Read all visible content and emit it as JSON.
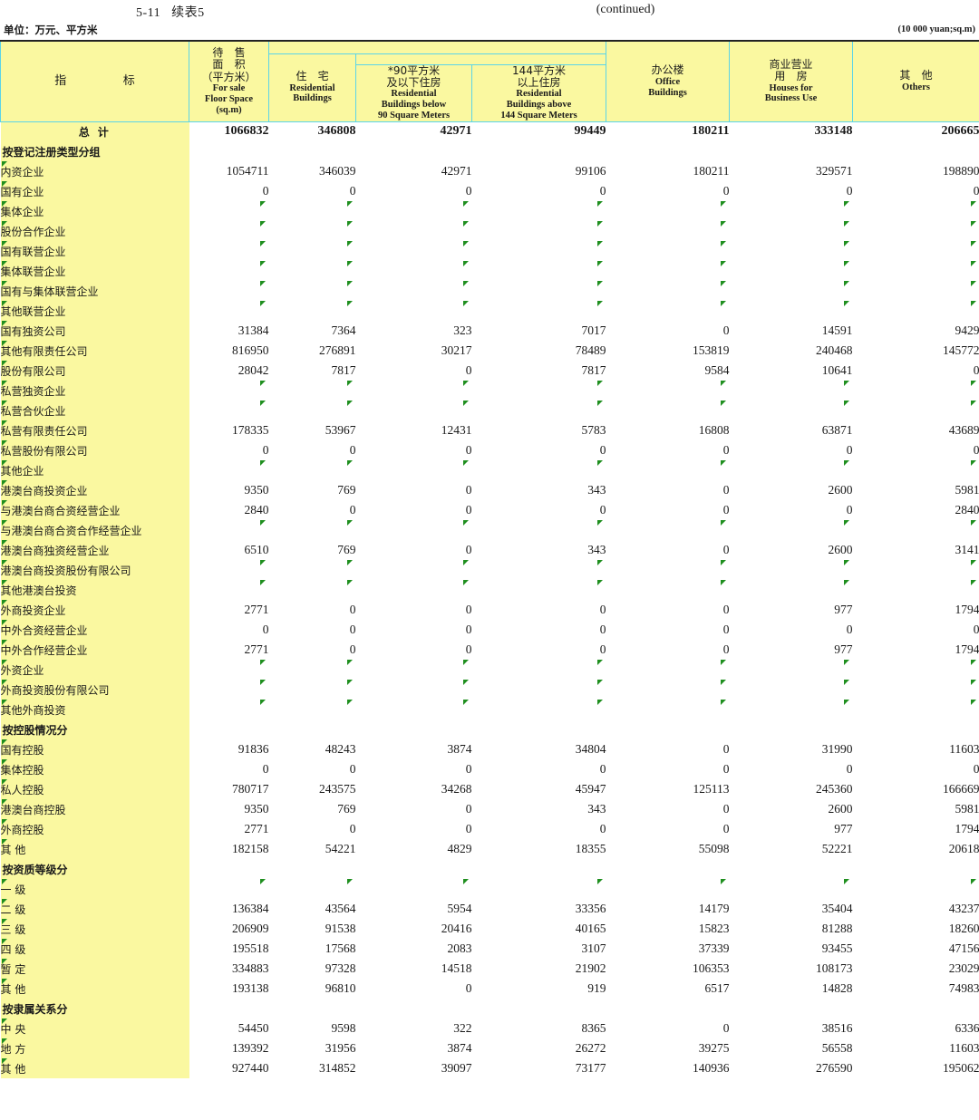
{
  "page": {
    "table_number": "5-11",
    "table_title_cn": "续表5",
    "continued_label": "(continued)",
    "unit_cn": "单位：万元、平方米",
    "unit_en": "(10 000 yuan;sq.m)",
    "colors": {
      "header_fill": "#FAF8A0",
      "grid_line": "#5BD4E8",
      "outer_line": "#222222",
      "error_marker": "#1F8F1F"
    }
  },
  "header": {
    "indicator_left": "指",
    "indicator_right": "标",
    "columns": [
      {
        "cn1": "待  售",
        "cn2": "面  积",
        "cn3": "（平方米）",
        "en1": "For sale",
        "en2": "Floor Space",
        "en3": "(sq.m)"
      },
      {
        "cn1": "住  宅",
        "en1": "Residential",
        "en2": "Buildings"
      },
      {
        "cn1": "*90平方米",
        "cn2": "及以下住房",
        "en1": "Residential",
        "en2": "Buildings below",
        "en3": "90 Square Meters"
      },
      {
        "cn1": "144平方米",
        "cn2": "以上住房",
        "en1": "Residential",
        "en2": "Buildings above",
        "en3": "144 Square Meters"
      },
      {
        "cn1": "办公楼",
        "en1": "Office",
        "en2": "Buildings"
      },
      {
        "cn1": "商业营业",
        "cn2": "用  房",
        "en1": "Houses for",
        "en2": "Business Use"
      },
      {
        "cn1": "其  他",
        "en1": "Others"
      }
    ]
  },
  "chart_data": {
    "type": "table",
    "title": "5-11 续表5 (continued)",
    "units": "万元、平方米 / 10 000 yuan; sq.m",
    "columns": [
      "待售面积（平方米） For sale Floor Space (sq.m)",
      "住宅 Residential Buildings",
      "*90平方米及以下住房 Residential Buildings below 90 Square Meters",
      "144平方米以上住房 Residential Buildings above 144 Square Meters",
      "办公楼 Office Buildings",
      "商业营业用房 Houses for Business Use",
      "其他 Others"
    ],
    "rows": [
      {
        "label": "总        计",
        "kind": "total",
        "indent": 0,
        "values": [
          "1066832",
          "346808",
          "42971",
          "99449",
          "180211",
          "333148",
          "206665"
        ]
      },
      {
        "label": "按登记注册类型分组",
        "kind": "group",
        "indent": 0,
        "values": [
          "",
          "",
          "",
          "",
          "",
          "",
          ""
        ]
      },
      {
        "label": "内资企业",
        "kind": "data",
        "indent": 1,
        "values": [
          "1054711",
          "346039",
          "42971",
          "99106",
          "180211",
          "329571",
          "198890"
        ]
      },
      {
        "label": "国有企业",
        "kind": "data",
        "indent": 2,
        "values": [
          "0",
          "0",
          "0",
          "0",
          "0",
          "0",
          "0"
        ]
      },
      {
        "label": "集体企业",
        "kind": "empty",
        "indent": 2,
        "values": [
          "",
          "",
          "",
          "",
          "",
          "",
          ""
        ]
      },
      {
        "label": "股份合作企业",
        "kind": "empty",
        "indent": 2,
        "values": [
          "",
          "",
          "",
          "",
          "",
          "",
          ""
        ]
      },
      {
        "label": "国有联营企业",
        "kind": "empty",
        "indent": 2,
        "values": [
          "",
          "",
          "",
          "",
          "",
          "",
          ""
        ]
      },
      {
        "label": "集体联营企业",
        "kind": "empty",
        "indent": 2,
        "values": [
          "",
          "",
          "",
          "",
          "",
          "",
          ""
        ]
      },
      {
        "label": "国有与集体联营企业",
        "kind": "empty",
        "indent": 2,
        "values": [
          "",
          "",
          "",
          "",
          "",
          "",
          ""
        ]
      },
      {
        "label": "其他联营企业",
        "kind": "empty",
        "indent": 2,
        "values": [
          "",
          "",
          "",
          "",
          "",
          "",
          ""
        ]
      },
      {
        "label": "国有独资公司",
        "kind": "data",
        "indent": 2,
        "values": [
          "31384",
          "7364",
          "323",
          "7017",
          "0",
          "14591",
          "9429"
        ]
      },
      {
        "label": "其他有限责任公司",
        "kind": "data",
        "indent": 2,
        "values": [
          "816950",
          "276891",
          "30217",
          "78489",
          "153819",
          "240468",
          "145772"
        ]
      },
      {
        "label": "股份有限公司",
        "kind": "data",
        "indent": 2,
        "values": [
          "28042",
          "7817",
          "0",
          "7817",
          "9584",
          "10641",
          "0"
        ]
      },
      {
        "label": "私营独资企业",
        "kind": "empty",
        "indent": 2,
        "values": [
          "",
          "",
          "",
          "",
          "",
          "",
          ""
        ]
      },
      {
        "label": "私营合伙企业",
        "kind": "empty",
        "indent": 2,
        "values": [
          "",
          "",
          "",
          "",
          "",
          "",
          ""
        ]
      },
      {
        "label": "私营有限责任公司",
        "kind": "data",
        "indent": 2,
        "values": [
          "178335",
          "53967",
          "12431",
          "5783",
          "16808",
          "63871",
          "43689"
        ]
      },
      {
        "label": "私营股份有限公司",
        "kind": "data",
        "indent": 2,
        "values": [
          "0",
          "0",
          "0",
          "0",
          "0",
          "0",
          "0"
        ]
      },
      {
        "label": "其他企业",
        "kind": "empty",
        "indent": 2,
        "values": [
          "",
          "",
          "",
          "",
          "",
          "",
          ""
        ]
      },
      {
        "label": "港澳台商投资企业",
        "kind": "data",
        "indent": 1,
        "values": [
          "9350",
          "769",
          "0",
          "343",
          "0",
          "2600",
          "5981"
        ]
      },
      {
        "label": "与港澳台商合资经营企业",
        "kind": "data",
        "indent": 2,
        "values": [
          "2840",
          "0",
          "0",
          "0",
          "0",
          "0",
          "2840"
        ]
      },
      {
        "label": "与港澳台商合资合作经营企业",
        "kind": "empty",
        "indent": 2,
        "values": [
          "",
          "",
          "",
          "",
          "",
          "",
          ""
        ]
      },
      {
        "label": "港澳台商独资经营企业",
        "kind": "data",
        "indent": 2,
        "values": [
          "6510",
          "769",
          "0",
          "343",
          "0",
          "2600",
          "3141"
        ]
      },
      {
        "label": "港澳台商投资股份有限公司",
        "kind": "empty",
        "indent": 2,
        "values": [
          "",
          "",
          "",
          "",
          "",
          "",
          ""
        ]
      },
      {
        "label": "其他港澳台投资",
        "kind": "empty",
        "indent": 2,
        "values": [
          "",
          "",
          "",
          "",
          "",
          "",
          ""
        ]
      },
      {
        "label": "外商投资企业",
        "kind": "data",
        "indent": 1,
        "values": [
          "2771",
          "0",
          "0",
          "0",
          "0",
          "977",
          "1794"
        ]
      },
      {
        "label": "中外合资经营企业",
        "kind": "data",
        "indent": 2,
        "values": [
          "0",
          "0",
          "0",
          "0",
          "0",
          "0",
          "0"
        ]
      },
      {
        "label": "中外合作经营企业",
        "kind": "data",
        "indent": 2,
        "values": [
          "2771",
          "0",
          "0",
          "0",
          "0",
          "977",
          "1794"
        ]
      },
      {
        "label": "外资企业",
        "kind": "empty",
        "indent": 2,
        "values": [
          "",
          "",
          "",
          "",
          "",
          "",
          ""
        ]
      },
      {
        "label": "外商投资股份有限公司",
        "kind": "empty",
        "indent": 2,
        "values": [
          "",
          "",
          "",
          "",
          "",
          "",
          ""
        ]
      },
      {
        "label": "其他外商投资",
        "kind": "empty",
        "indent": 2,
        "values": [
          "",
          "",
          "",
          "",
          "",
          "",
          ""
        ]
      },
      {
        "label": "按控股情况分",
        "kind": "group",
        "indent": 0,
        "values": [
          "",
          "",
          "",
          "",
          "",
          "",
          ""
        ]
      },
      {
        "label": "国有控股",
        "kind": "data",
        "indent": 1,
        "values": [
          "91836",
          "48243",
          "3874",
          "34804",
          "0",
          "31990",
          "11603"
        ]
      },
      {
        "label": "集体控股",
        "kind": "data",
        "indent": 1,
        "values": [
          "0",
          "0",
          "0",
          "0",
          "0",
          "0",
          "0"
        ]
      },
      {
        "label": "私人控股",
        "kind": "data",
        "indent": 1,
        "values": [
          "780717",
          "243575",
          "34268",
          "45947",
          "125113",
          "245360",
          "166669"
        ]
      },
      {
        "label": "港澳台商控股",
        "kind": "data",
        "indent": 1,
        "values": [
          "9350",
          "769",
          "0",
          "343",
          "0",
          "2600",
          "5981"
        ]
      },
      {
        "label": "外商控股",
        "kind": "data",
        "indent": 1,
        "values": [
          "2771",
          "0",
          "0",
          "0",
          "0",
          "977",
          "1794"
        ]
      },
      {
        "label": "其  他",
        "kind": "data",
        "indent": 1,
        "values": [
          "182158",
          "54221",
          "4829",
          "18355",
          "55098",
          "52221",
          "20618"
        ]
      },
      {
        "label": "按资质等级分",
        "kind": "group",
        "indent": 0,
        "values": [
          "",
          "",
          "",
          "",
          "",
          "",
          ""
        ]
      },
      {
        "label": "一    级",
        "kind": "empty",
        "indent": 1,
        "values": [
          "",
          "",
          "",
          "",
          "",
          "",
          ""
        ]
      },
      {
        "label": "二    级",
        "kind": "data",
        "indent": 1,
        "values": [
          "136384",
          "43564",
          "5954",
          "33356",
          "14179",
          "35404",
          "43237"
        ]
      },
      {
        "label": "三    级",
        "kind": "data",
        "indent": 1,
        "values": [
          "206909",
          "91538",
          "20416",
          "40165",
          "15823",
          "81288",
          "18260"
        ]
      },
      {
        "label": "四    级",
        "kind": "data",
        "indent": 1,
        "values": [
          "195518",
          "17568",
          "2083",
          "3107",
          "37339",
          "93455",
          "47156"
        ]
      },
      {
        "label": "暂    定",
        "kind": "data",
        "indent": 1,
        "values": [
          "334883",
          "97328",
          "14518",
          "21902",
          "106353",
          "108173",
          "23029"
        ]
      },
      {
        "label": "其    他",
        "kind": "data",
        "indent": 1,
        "values": [
          "193138",
          "96810",
          "0",
          "919",
          "6517",
          "14828",
          "74983"
        ]
      },
      {
        "label": "按隶属关系分",
        "kind": "group",
        "indent": 0,
        "values": [
          "",
          "",
          "",
          "",
          "",
          "",
          ""
        ]
      },
      {
        "label": "中    央",
        "kind": "data",
        "indent": 1,
        "values": [
          "54450",
          "9598",
          "322",
          "8365",
          "0",
          "38516",
          "6336"
        ]
      },
      {
        "label": "地    方",
        "kind": "data",
        "indent": 1,
        "values": [
          "139392",
          "31956",
          "3874",
          "26272",
          "39275",
          "56558",
          "11603"
        ]
      },
      {
        "label": "其    他",
        "kind": "data",
        "indent": 1,
        "values": [
          "927440",
          "314852",
          "39097",
          "73177",
          "140936",
          "276590",
          "195062"
        ]
      }
    ],
    "empty_cell_marker": "green-triangle",
    "marker_note": "Cells with no value carry a small green triangle indicator in the corner"
  }
}
